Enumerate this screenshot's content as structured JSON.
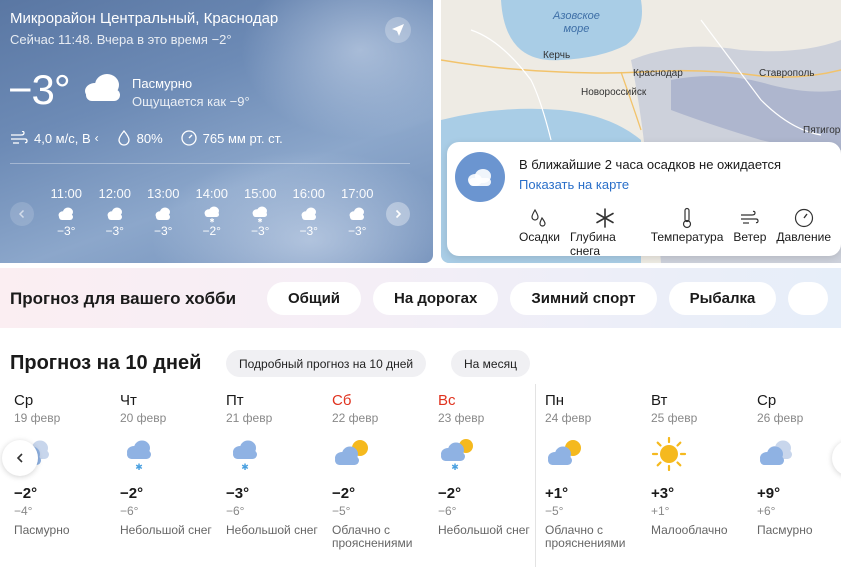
{
  "current": {
    "location": "Микрорайон Центральный, Краснодар",
    "subtitle": "Сейчас 11:48. Вчера в это время −2°",
    "temperature": "−3°",
    "condition": "Пасмурно",
    "feels_like": "Ощущается как −9°",
    "wind": "4,0 м/с, В",
    "wind_dir_glyph": "‹",
    "humidity": "80%",
    "pressure": "765 мм рт. ст.",
    "hourly": [
      {
        "time": "11:00",
        "temp": "−3°",
        "icon": "cloudy-icon"
      },
      {
        "time": "12:00",
        "temp": "−3°",
        "icon": "cloudy-icon"
      },
      {
        "time": "13:00",
        "temp": "−3°",
        "icon": "cloudy-icon"
      },
      {
        "time": "14:00",
        "temp": "−2°",
        "icon": "light-snow-icon"
      },
      {
        "time": "15:00",
        "temp": "−3°",
        "icon": "light-snow-icon"
      },
      {
        "time": "16:00",
        "temp": "−3°",
        "icon": "cloudy-icon"
      },
      {
        "time": "17:00",
        "temp": "−3°",
        "icon": "cloudy-icon"
      }
    ]
  },
  "map": {
    "sea_label_1": "Азовское",
    "sea_label_2": "море",
    "cities": {
      "kerch": "Керчь",
      "krasnodar": "Краснодар",
      "stavropol": "Ставрополь",
      "novorossiysk": "Новороссийск",
      "pyatigorsk": "Пятигор"
    },
    "precip_title": "В ближайшие 2 часа осадков не ожидается",
    "precip_link": "Показать на карте",
    "layers": [
      {
        "label": "Осадки",
        "icon": "precipitation-icon"
      },
      {
        "label": "Глубина снега",
        "icon": "snowflake-icon"
      },
      {
        "label": "Температура",
        "icon": "thermometer-icon"
      },
      {
        "label": "Ветер",
        "icon": "wind-icon"
      },
      {
        "label": "Давление",
        "icon": "pressure-icon"
      }
    ]
  },
  "hobby": {
    "title": "Прогноз для вашего хобби",
    "chips": [
      "Общий",
      "На дорогах",
      "Зимний спорт",
      "Рыбалка"
    ]
  },
  "ten_days": {
    "title": "Прогноз на 10 дней",
    "detail_button": "Подробный прогноз на 10 дней",
    "month_button": "На месяц",
    "days": [
      {
        "name": "Ср",
        "date": "19 февр",
        "hi": "−2°",
        "lo": "−4°",
        "cond": "Пасмурно",
        "icon": "overcast-icon",
        "weekend": false
      },
      {
        "name": "Чт",
        "date": "20 февр",
        "hi": "−2°",
        "lo": "−6°",
        "cond": "Небольшой снег",
        "icon": "light-snow-icon",
        "weekend": false
      },
      {
        "name": "Пт",
        "date": "21 февр",
        "hi": "−3°",
        "lo": "−6°",
        "cond": "Небольшой снег",
        "icon": "light-snow-icon",
        "weekend": false
      },
      {
        "name": "Сб",
        "date": "22 февр",
        "hi": "−2°",
        "lo": "−5°",
        "cond": "Облачно с прояснениями",
        "icon": "partly-cloudy-icon",
        "weekend": true
      },
      {
        "name": "Вс",
        "date": "23 февр",
        "hi": "−2°",
        "lo": "−6°",
        "cond": "Небольшой снег",
        "icon": "sun-snow-icon",
        "weekend": true
      },
      {
        "name": "Пн",
        "date": "24 февр",
        "hi": "+1°",
        "lo": "−5°",
        "cond": "Облачно с прояснениями",
        "icon": "partly-cloudy-icon",
        "weekend": false
      },
      {
        "name": "Вт",
        "date": "25 февр",
        "hi": "+3°",
        "lo": "+1°",
        "cond": "Малооблачно",
        "icon": "sun-icon",
        "weekend": false
      },
      {
        "name": "Ср",
        "date": "26 февр",
        "hi": "+9°",
        "lo": "+6°",
        "cond": "Пасмурно",
        "icon": "overcast-icon",
        "weekend": false
      }
    ]
  },
  "colors": {
    "link": "#2a6fc9",
    "weekend": "#e0321e",
    "sun": "#f5b91e",
    "cloud": "#8fb2e3"
  }
}
